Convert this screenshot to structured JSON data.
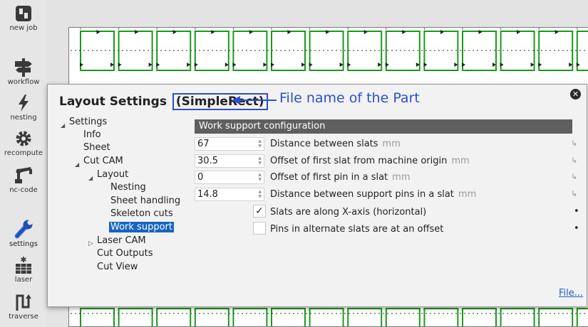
{
  "toolbar": {
    "items": [
      {
        "label": "new job",
        "icon": "new-job-icon"
      },
      {
        "label": "workflow",
        "icon": "signpost-icon"
      },
      {
        "label": "nesting",
        "icon": "lightning-icon"
      },
      {
        "label": "recompute",
        "icon": "gear-icon"
      },
      {
        "label": "nc-code",
        "icon": "robot-arm-icon"
      },
      {
        "label": "settings",
        "icon": "wrench-icon",
        "active": true
      },
      {
        "label": "laser",
        "icon": "laser-icon"
      },
      {
        "label": "traverse",
        "icon": "traverse-icon"
      }
    ]
  },
  "dialog": {
    "title": "Layout Settings",
    "part_name": "(SimpleRect)",
    "annotation": "File name of the Part",
    "file_link": "File..."
  },
  "tree": [
    {
      "label": "Settings",
      "expanded": true
    },
    {
      "label": "Info"
    },
    {
      "label": "Sheet"
    },
    {
      "label": "Cut CAM",
      "expanded": true
    },
    {
      "label": "Layout",
      "expanded": true
    },
    {
      "label": "Nesting"
    },
    {
      "label": "Sheet handling"
    },
    {
      "label": "Skeleton cuts"
    },
    {
      "label": "Work support",
      "selected": true
    },
    {
      "label": "Laser CAM",
      "expanded": false
    },
    {
      "label": "Cut Outputs"
    },
    {
      "label": "Cut View"
    }
  ],
  "panel": {
    "header": "Work support configuration",
    "fields": [
      {
        "value": "67",
        "label": "Distance between slats",
        "unit": "mm"
      },
      {
        "value": "30.5",
        "label": "Offset of first slat from machine origin",
        "unit": "mm"
      },
      {
        "value": "0",
        "label": "Offset of first pin in a slat",
        "unit": "mm"
      },
      {
        "value": "14.8",
        "label": "Distance between support pins in a slat",
        "unit": "mm"
      }
    ],
    "checkboxes": [
      {
        "label": "Slats are along X-axis (horizontal)",
        "checked": true,
        "mark": "✓"
      },
      {
        "label": "Pins in alternate slats are at an offset",
        "checked": false,
        "mark": ""
      }
    ]
  },
  "colors": {
    "accent": "#2b4fd0",
    "selection": "#1565c0",
    "part_outline": "#1a9a1a",
    "panel_header": "#5f5f5f"
  }
}
